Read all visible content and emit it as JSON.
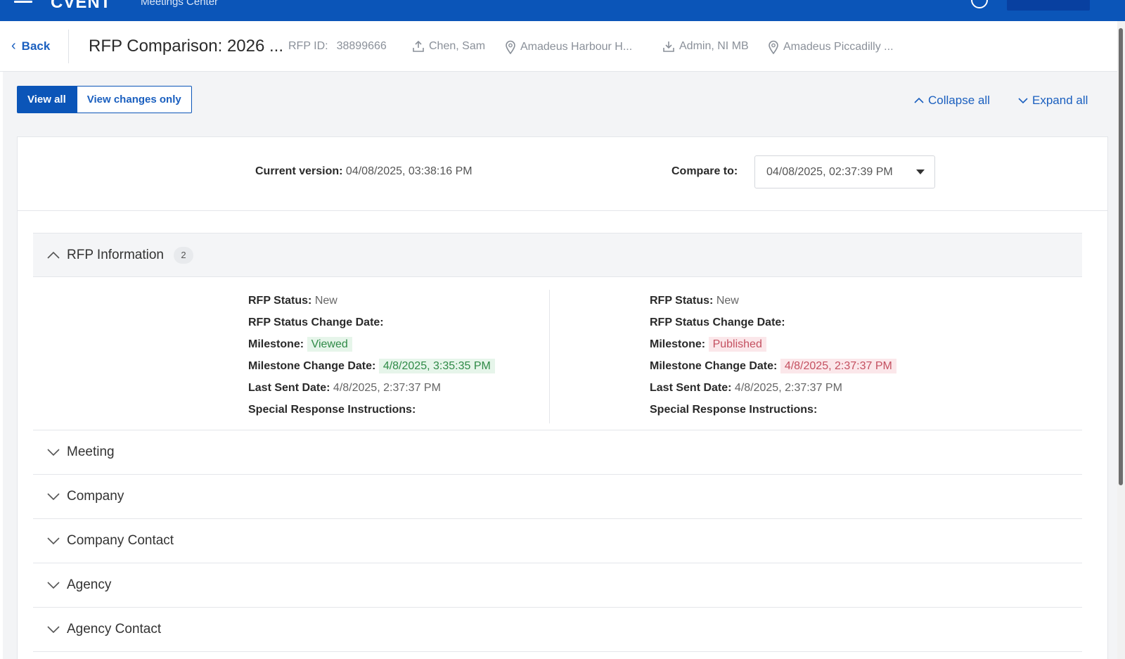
{
  "header": {
    "brand": "CVENT",
    "brand_sub": "Meetings Center"
  },
  "subheader": {
    "back_label": "Back",
    "title": "RFP Comparison: 2026 ...",
    "rfp_id_label": "RFP ID:",
    "rfp_id_value": "38899666",
    "sender": "Chen, Sam",
    "venue1": "Amadeus Harbour H...",
    "recipient": "Admin, NI MB",
    "venue2": "Amadeus Piccadilly ..."
  },
  "toolbar": {
    "view_all": "View all",
    "view_changes_only": "View changes only",
    "collapse_all": "Collapse all",
    "expand_all": "Expand all"
  },
  "versions": {
    "current_label": "Current version:",
    "current_value": "04/08/2025, 03:38:16 PM",
    "compare_label": "Compare to:",
    "compare_value": "04/08/2025, 02:37:39 PM"
  },
  "rfp_info": {
    "title": "RFP Information",
    "badge": "2",
    "left": {
      "status_label": "RFP Status:",
      "status_value": "New",
      "status_change_label": "RFP Status Change Date:",
      "milestone_label": "Milestone:",
      "milestone_value": "Viewed",
      "milestone_change_label": "Milestone Change Date:",
      "milestone_change_value": "4/8/2025, 3:35:35 PM",
      "last_sent_label": "Last Sent Date:",
      "last_sent_value": "4/8/2025, 2:37:37 PM",
      "special_label": "Special Response Instructions:"
    },
    "right": {
      "status_label": "RFP Status:",
      "status_value": "New",
      "status_change_label": "RFP Status Change Date:",
      "milestone_label": "Milestone:",
      "milestone_value": "Published",
      "milestone_change_label": "Milestone Change Date:",
      "milestone_change_value": "4/8/2025, 2:37:37 PM",
      "last_sent_label": "Last Sent Date:",
      "last_sent_value": "4/8/2025, 2:37:37 PM",
      "special_label": "Special Response Instructions:"
    }
  },
  "sections": [
    "Meeting",
    "Company",
    "Company Contact",
    "Agency",
    "Agency Contact"
  ],
  "colors": {
    "brand_blue": "#0b55b8",
    "link_blue": "#1a5fbf",
    "added_green": "#2f8a47",
    "removed_red": "#c45060"
  }
}
